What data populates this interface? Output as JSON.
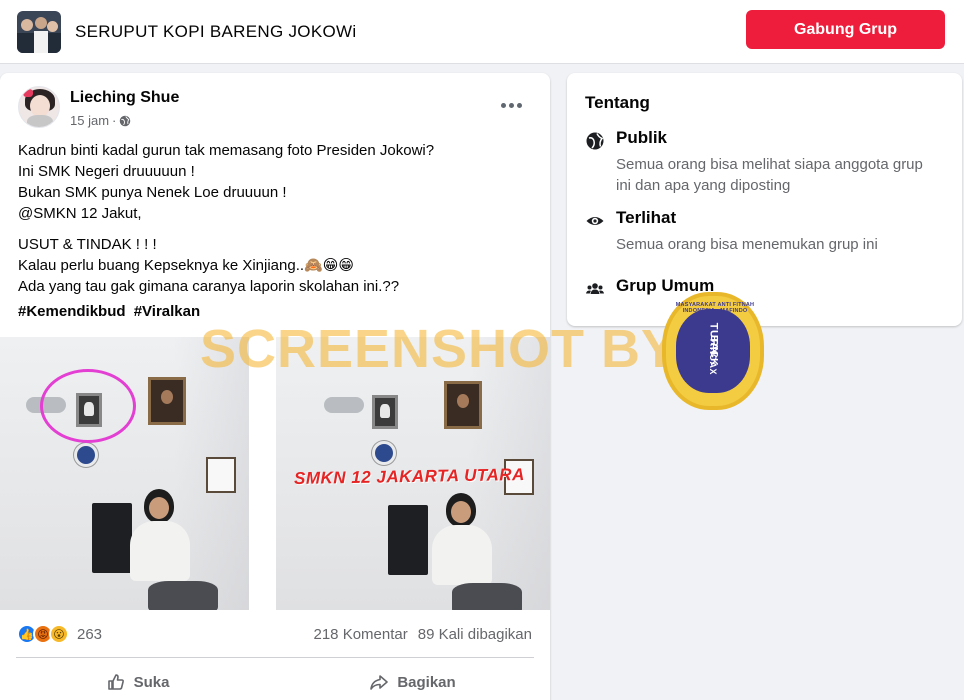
{
  "header": {
    "group_name": "SERUPUT KOPI BARENG JOKOWi",
    "join_button": "Gabung Grup"
  },
  "post": {
    "author": "Lieching Shue",
    "time": "15 jam",
    "audience_icon": "globe-icon",
    "lines_a": [
      "Kadrun binti kadal gurun tak memasang foto Presiden Jokowi?",
      "Ini SMK Negeri druuuuun !",
      "Bukan SMK punya Nenek Loe druuuun !",
      "@SMKN 12 Jakut,"
    ],
    "lines_b": [
      "USUT & TINDAK ! ! !",
      "Kalau perlu buang Kepseknya ke Xinjiang..🙈😁😁",
      "Ada yang tau gak gimana caranya laporin skolahan ini.??"
    ],
    "hashtags": [
      "#Kemendikbud",
      "#Viralkan"
    ],
    "photo_caption": "SMKN 12 JAKARTA UTARA",
    "reaction_icons": [
      "like-icon",
      "angry-icon",
      "wow-icon"
    ],
    "reaction_count": "263",
    "comments": "218 Komentar",
    "shares": "89 Kali dibagikan",
    "actions": {
      "like": "Suka",
      "share": "Bagikan"
    }
  },
  "overlay": {
    "watermark": "SCREENSHOT BY",
    "seal_lines": [
      "TURN",
      "BACK",
      "HOAX"
    ],
    "seal_ring": "MASYARAKAT ANTI FITNAH INDONESIA · MAFINDO",
    "colors": {
      "watermark": "#f5b228",
      "seal_bg": "#f3cc42",
      "seal_inner": "#3c3a8f"
    }
  },
  "about": {
    "title": "Tentang",
    "items": [
      {
        "icon": "globe-icon",
        "title": "Publik",
        "desc": "Semua orang bisa melihat siapa anggota grup ini dan apa yang diposting"
      },
      {
        "icon": "eye-icon",
        "title": "Terlihat",
        "desc": "Semua orang bisa menemukan grup ini"
      },
      {
        "icon": "people-icon",
        "title": "Grup Umum",
        "desc": ""
      }
    ]
  },
  "colors": {
    "join_button_bg": "#ee1d3b",
    "page_bg": "#f0f2f5",
    "secondary_text": "#65676b"
  }
}
